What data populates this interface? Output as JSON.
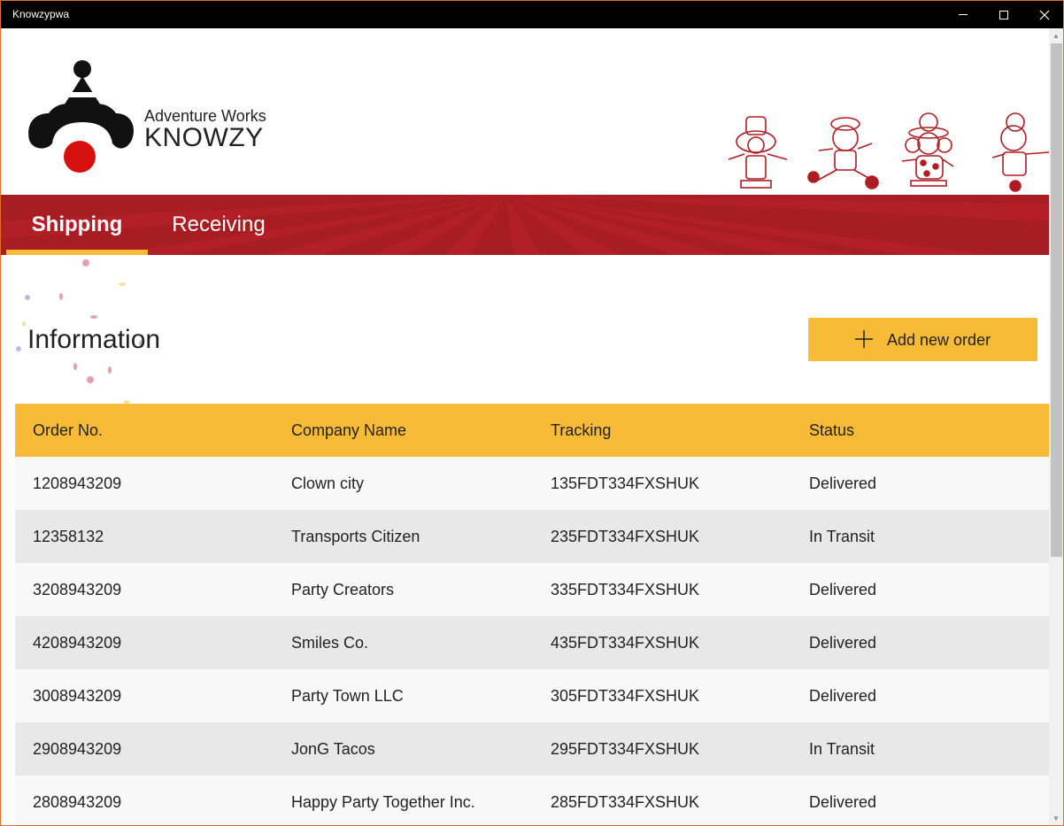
{
  "window": {
    "title": "Knowzypwa"
  },
  "brand": {
    "top_line": "Adventure Works",
    "main_line": "KNOWZY",
    "logo_icon": "clown-logo-icon",
    "accent_red": "#a81d22",
    "accent_yellow": "#f8bb37"
  },
  "nav": {
    "tabs": [
      {
        "label": "Shipping",
        "selected": true
      },
      {
        "label": "Receiving",
        "selected": false
      }
    ]
  },
  "main": {
    "title": "Information",
    "add_button": {
      "label": "Add new order",
      "icon": "plus-icon"
    }
  },
  "table": {
    "columns": [
      "Order No.",
      "Company Name",
      "Tracking",
      "Status"
    ],
    "rows": [
      [
        "1208943209",
        "Clown city",
        "135FDT334FXSHUK",
        "Delivered"
      ],
      [
        "12358132",
        "Transports Citizen",
        "235FDT334FXSHUK",
        "In Transit"
      ],
      [
        "3208943209",
        "Party Creators",
        "335FDT334FXSHUK",
        "Delivered"
      ],
      [
        "4208943209",
        "Smiles Co.",
        "435FDT334FXSHUK",
        "Delivered"
      ],
      [
        "3008943209",
        "Party Town LLC",
        "305FDT334FXSHUK",
        "Delivered"
      ],
      [
        "2908943209",
        "JonG Tacos",
        "295FDT334FXSHUK",
        "In Transit"
      ],
      [
        "2808943209",
        "Happy Party Together Inc.",
        "285FDT334FXSHUK",
        "Delivered"
      ]
    ]
  }
}
